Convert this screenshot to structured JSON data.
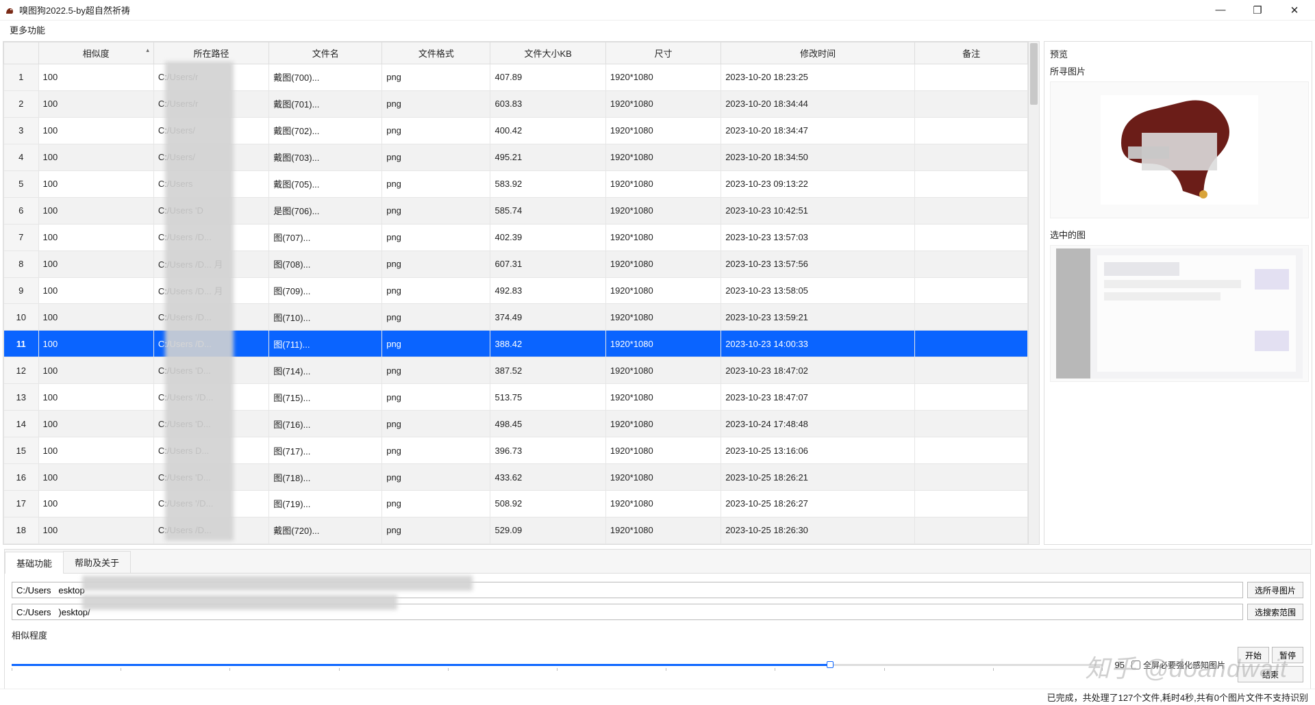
{
  "window": {
    "title": "嗅图狗2022.5-by超自然祈祷",
    "min": "—",
    "max": "❐",
    "close": "✕"
  },
  "menu": {
    "more": "更多功能"
  },
  "table": {
    "headers": {
      "rownum": "",
      "similarity": "相似度",
      "path": "所在路径",
      "filename": "文件名",
      "format": "文件格式",
      "sizeKB": "文件大小KB",
      "dims": "尺寸",
      "mtime": "修改时间",
      "note": "备注"
    },
    "selected_index": 11,
    "rows": [
      {
        "n": 1,
        "sim": "100",
        "path": "C:/Users/r",
        "fname": "戴图(700)...",
        "fmt": "png",
        "size": "407.89",
        "dims": "1920*1080",
        "mtime": "2023-10-20 18:23:25",
        "note": ""
      },
      {
        "n": 2,
        "sim": "100",
        "path": "C:/Users/r",
        "fname": "戴图(701)...",
        "fmt": "png",
        "size": "603.83",
        "dims": "1920*1080",
        "mtime": "2023-10-20 18:34:44",
        "note": ""
      },
      {
        "n": 3,
        "sim": "100",
        "path": "C:/Users/",
        "fname": "戴图(702)...",
        "fmt": "png",
        "size": "400.42",
        "dims": "1920*1080",
        "mtime": "2023-10-20 18:34:47",
        "note": ""
      },
      {
        "n": 4,
        "sim": "100",
        "path": "C:/Users/",
        "fname": "戴图(703)...",
        "fmt": "png",
        "size": "495.21",
        "dims": "1920*1080",
        "mtime": "2023-10-20 18:34:50",
        "note": ""
      },
      {
        "n": 5,
        "sim": "100",
        "path": "C:/Users",
        "fname": "戴图(705)...",
        "fmt": "png",
        "size": "583.92",
        "dims": "1920*1080",
        "mtime": "2023-10-23 09:13:22",
        "note": ""
      },
      {
        "n": 6,
        "sim": "100",
        "path": "C:/Users   'D",
        "fname": "是图(706)...",
        "fmt": "png",
        "size": "585.74",
        "dims": "1920*1080",
        "mtime": "2023-10-23 10:42:51",
        "note": ""
      },
      {
        "n": 7,
        "sim": "100",
        "path": "C:/Users   /D...",
        "fname": "图(707)...",
        "fmt": "png",
        "size": "402.39",
        "dims": "1920*1080",
        "mtime": "2023-10-23 13:57:03",
        "note": ""
      },
      {
        "n": 8,
        "sim": "100",
        "path": "C:/Users   /D... 月",
        "fname": "图(708)...",
        "fmt": "png",
        "size": "607.31",
        "dims": "1920*1080",
        "mtime": "2023-10-23 13:57:56",
        "note": ""
      },
      {
        "n": 9,
        "sim": "100",
        "path": "C:/Users   /D... 月",
        "fname": "图(709)...",
        "fmt": "png",
        "size": "492.83",
        "dims": "1920*1080",
        "mtime": "2023-10-23 13:58:05",
        "note": ""
      },
      {
        "n": 10,
        "sim": "100",
        "path": "C:/Users   /D...",
        "fname": "图(710)...",
        "fmt": "png",
        "size": "374.49",
        "dims": "1920*1080",
        "mtime": "2023-10-23 13:59:21",
        "note": ""
      },
      {
        "n": 11,
        "sim": "100",
        "path": "C:/Users   /D...",
        "fname": "图(711)...",
        "fmt": "png",
        "size": "388.42",
        "dims": "1920*1080",
        "mtime": "2023-10-23 14:00:33",
        "note": ""
      },
      {
        "n": 12,
        "sim": "100",
        "path": "C:/Users   'D...",
        "fname": "图(714)...",
        "fmt": "png",
        "size": "387.52",
        "dims": "1920*1080",
        "mtime": "2023-10-23 18:47:02",
        "note": ""
      },
      {
        "n": 13,
        "sim": "100",
        "path": "C:/Users   '/D...",
        "fname": "图(715)...",
        "fmt": "png",
        "size": "513.75",
        "dims": "1920*1080",
        "mtime": "2023-10-23 18:47:07",
        "note": ""
      },
      {
        "n": 14,
        "sim": "100",
        "path": "C:/Users   'D...",
        "fname": "图(716)...",
        "fmt": "png",
        "size": "498.45",
        "dims": "1920*1080",
        "mtime": "2023-10-24 17:48:48",
        "note": ""
      },
      {
        "n": 15,
        "sim": "100",
        "path": "C:/Users    D...",
        "fname": "图(717)...",
        "fmt": "png",
        "size": "396.73",
        "dims": "1920*1080",
        "mtime": "2023-10-25 13:16:06",
        "note": ""
      },
      {
        "n": 16,
        "sim": "100",
        "path": "C:/Users   'D...",
        "fname": "图(718)...",
        "fmt": "png",
        "size": "433.62",
        "dims": "1920*1080",
        "mtime": "2023-10-25 18:26:21",
        "note": ""
      },
      {
        "n": 17,
        "sim": "100",
        "path": "C:/Users   '/D...",
        "fname": "图(719)...",
        "fmt": "png",
        "size": "508.92",
        "dims": "1920*1080",
        "mtime": "2023-10-25 18:26:27",
        "note": ""
      },
      {
        "n": 18,
        "sim": "100",
        "path": "C:/Users    /D...",
        "fname": "戴图(720)...",
        "fmt": "png",
        "size": "529.09",
        "dims": "1920*1080",
        "mtime": "2023-10-25 18:26:30",
        "note": ""
      }
    ]
  },
  "right": {
    "panel_title": "预览",
    "label_source": "所寻图片",
    "label_selected": "选中的图"
  },
  "tabs": {
    "basic": "基础功能",
    "help": "帮助及关于"
  },
  "form": {
    "path1": "C:/Users   esktop",
    "path2": "C:/Users   )esktop/",
    "btn_pick_image": "选所寻图片",
    "btn_pick_scope": "选搜索范围",
    "slider_label": "相似程度",
    "slider_value": "95",
    "checkbox_label": "全屏必要强化感知图片",
    "btn_start": "开始",
    "btn_pause": "暂停",
    "btn_end": "结束"
  },
  "status": {
    "text": "已完成，共处理了127个文件,耗时4秒,共有0个图片文件不支持识别"
  },
  "watermark": "知乎 @doandwait"
}
